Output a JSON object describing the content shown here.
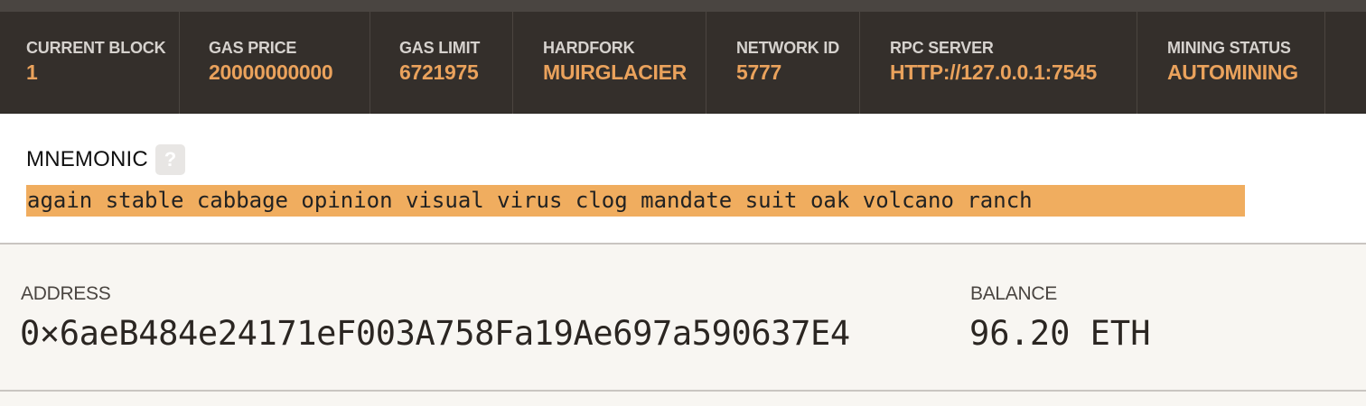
{
  "status_bar": {
    "items": [
      {
        "label": "CURRENT BLOCK",
        "value": "1"
      },
      {
        "label": "GAS PRICE",
        "value": "20000000000"
      },
      {
        "label": "GAS LIMIT",
        "value": "6721975"
      },
      {
        "label": "HARDFORK",
        "value": "MUIRGLACIER"
      },
      {
        "label": "NETWORK ID",
        "value": "5777"
      },
      {
        "label": "RPC SERVER",
        "value": "HTTP://127.0.0.1:7545"
      },
      {
        "label": "MINING STATUS",
        "value": "AUTOMINING"
      }
    ],
    "accent_color": "#eaa25c",
    "background_color": "#342f2b"
  },
  "mnemonic": {
    "title": "MNEMONIC",
    "help_icon": "question-mark-icon",
    "help_glyph": "?",
    "phrase": "again stable cabbage opinion visual virus clog mandate suit oak volcano ranch",
    "highlight_color": "#f0ad5f"
  },
  "account": {
    "address_label": "ADDRESS",
    "address": "0×6aeB484e24171eF003A758Fa19Ae697a590637E4",
    "balance_label": "BALANCE",
    "balance": "96.20 ETH"
  }
}
